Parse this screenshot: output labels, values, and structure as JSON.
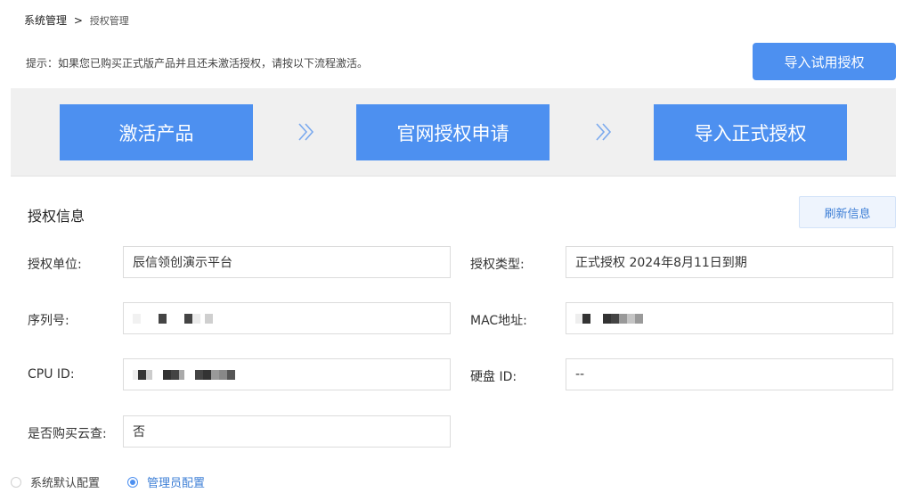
{
  "breadcrumb": {
    "parent": "系统管理",
    "separator": ">",
    "current": "授权管理"
  },
  "hint": "提示：如果您已购买正式版产品并且还未激活授权，请按以下流程激活。",
  "actions": {
    "import_trial": "导入试用授权"
  },
  "steps": [
    {
      "label": "激活产品"
    },
    {
      "label": "官网授权申请"
    },
    {
      "label": "导入正式授权"
    }
  ],
  "auth_info": {
    "title": "授权信息",
    "refresh": "刷新信息",
    "fields": {
      "unit": {
        "label": "授权单位:",
        "value": "辰信领创演示平台"
      },
      "type": {
        "label": "授权类型:",
        "value": "正式授权 2024年8月11日到期"
      },
      "serial": {
        "label": "序列号:",
        "value": ""
      },
      "mac": {
        "label": "MAC地址:",
        "value": ""
      },
      "cpu": {
        "label": "CPU ID:",
        "value": ""
      },
      "disk": {
        "label": "硬盘 ID:",
        "value": "--"
      },
      "cloud": {
        "label": "是否购买云查:",
        "value": "否"
      }
    }
  },
  "config_mode": {
    "options": [
      {
        "label": "系统默认配置",
        "checked": false
      },
      {
        "label": "管理员配置",
        "checked": true
      }
    ]
  },
  "colors": {
    "primary": "#4d90f0",
    "link": "#3e7fd6",
    "band": "#f0f0f0"
  }
}
